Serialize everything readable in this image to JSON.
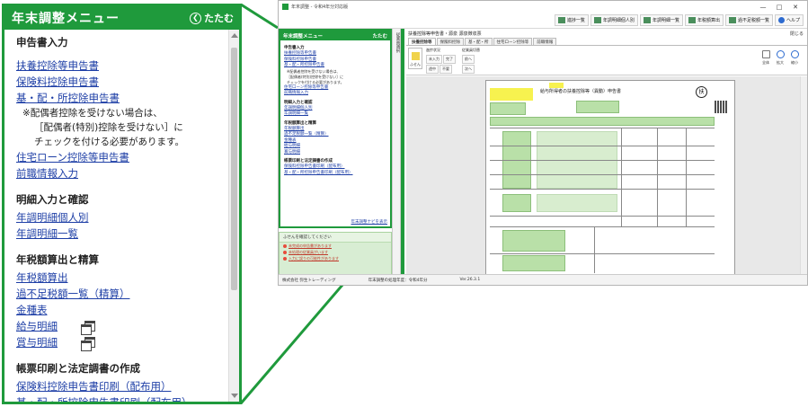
{
  "zoom_panel": {
    "title": "年末調整メニュー",
    "collapse_label": "たたむ",
    "sections": [
      {
        "heading": "申告書入力",
        "items": [
          {
            "type": "link",
            "label": "扶養控除等申告書"
          },
          {
            "type": "link",
            "label": "保険料控除申告書"
          },
          {
            "type": "link",
            "label": "基・配・所控除申告書"
          },
          {
            "type": "note",
            "label": "※配偶者控除を受けない場合は、"
          },
          {
            "type": "note-indent",
            "label": "［配偶者(特別)控除を受けない］に"
          },
          {
            "type": "note-indent",
            "label": "チェックを付ける必要があります。"
          },
          {
            "type": "link",
            "label": "住宅ローン控除等申告書"
          },
          {
            "type": "link",
            "label": "前職情報入力"
          }
        ]
      },
      {
        "heading": "明細入力と確認",
        "items": [
          {
            "type": "link",
            "label": "年調明細個人別"
          },
          {
            "type": "link",
            "label": "年調明細一覧"
          }
        ]
      },
      {
        "heading": "年税額算出と精算",
        "items": [
          {
            "type": "link",
            "label": "年税額算出"
          },
          {
            "type": "link",
            "label": "過不足税額一覧（精算）"
          },
          {
            "type": "link",
            "label": "金種表"
          },
          {
            "type": "link-icon",
            "label": "給与明細"
          },
          {
            "type": "link-icon",
            "label": "賞与明細"
          }
        ]
      },
      {
        "heading": "帳票印刷と法定調書の作成",
        "items": [
          {
            "type": "link",
            "label": "保険料控除申告書印刷（配布用）"
          },
          {
            "type": "link",
            "label": "基・配・所控除申告書印刷（配布用）"
          }
        ]
      }
    ]
  },
  "app": {
    "window_title": "年末調整 - 令和4年分対応版",
    "window_controls": [
      "—",
      "□",
      "✕"
    ],
    "toolbar": [
      "進捗一覧",
      "年調明細個人別",
      "年調明細一覧",
      "年税額算出",
      "過不足税額一覧",
      "ヘルプ"
    ],
    "side_title": "年末調整メニュー",
    "side_collapse": "たたむ",
    "side_sections": [
      {
        "heading": "申告書入力",
        "items": [
          {
            "t": "link",
            "l": "扶養控除等申告書"
          },
          {
            "t": "link",
            "l": "保険料控除申告書"
          },
          {
            "t": "link",
            "l": "基・配・所控除申告書"
          },
          {
            "t": "note",
            "l": "※配偶者控除を受けない場合は、"
          },
          {
            "t": "note",
            "l": "［配偶者(特別)控除を受けない］に"
          },
          {
            "t": "note",
            "l": "チェックを付ける必要があります。"
          },
          {
            "t": "link",
            "l": "住宅ローン控除等申告書"
          },
          {
            "t": "link",
            "l": "前職情報入力"
          }
        ]
      },
      {
        "heading": "明細入力と確認",
        "items": [
          {
            "t": "link",
            "l": "年調明細個人別"
          },
          {
            "t": "link",
            "l": "年調明細一覧"
          }
        ]
      },
      {
        "heading": "年税額算出と精算",
        "items": [
          {
            "t": "link",
            "l": "年税額算出"
          },
          {
            "t": "link",
            "l": "過不足税額一覧（精算）"
          },
          {
            "t": "link",
            "l": "金種表"
          },
          {
            "t": "link",
            "l": "給与明細"
          },
          {
            "t": "link",
            "l": "賞与明細"
          }
        ]
      },
      {
        "heading": "帳票印刷と法定調書の作成",
        "items": [
          {
            "t": "link",
            "l": "保険料控除申告書印刷（配布用）"
          },
          {
            "t": "link",
            "l": "基・配・所控除申告書印刷（配布用）"
          }
        ]
      }
    ],
    "side_footer_link": "年末調整ナビを表示",
    "notice_heading": "ふせんを確認してください",
    "notice_items": [
      "未完成の申告書があります",
      "未処理の従業員がいます",
      "入力に誤りの可能性があります"
    ],
    "vertical_tab": "従業員選択",
    "doc_title": "扶養控除等申告書・源泉 源泉徴収票",
    "doc_close": "閉じる",
    "doc_tabs": [
      "扶養控除等",
      "保険料控除",
      "基・配・所",
      "住宅ローン控除等",
      "前職情報"
    ],
    "ribbon_big": "ふせん",
    "ribbon_groups": [
      {
        "label": "進捗状況",
        "row1": [
          "未入力",
          "完了"
        ],
        "row2": [
          "途中",
          "不要"
        ]
      },
      {
        "label": "従業員切替",
        "row1": [
          "前へ"
        ],
        "row2": [
          "次へ"
        ]
      }
    ],
    "ribbon_zoom": [
      "全体",
      "拡大",
      "縮小"
    ],
    "form_title": "給与所得者の扶養控除等（異動）申告書",
    "form_stamp": "扶",
    "status": [
      "株式会社 弥生トレーディング",
      "年末調整の処理年度：令和4年分",
      "Ver.26.3.1"
    ]
  },
  "colors": {
    "accent_green": "#1f9a3c",
    "link_blue": "#1e3fa6",
    "form_green": "#b9e0a8",
    "highlight_yellow": "#f7f24f"
  }
}
